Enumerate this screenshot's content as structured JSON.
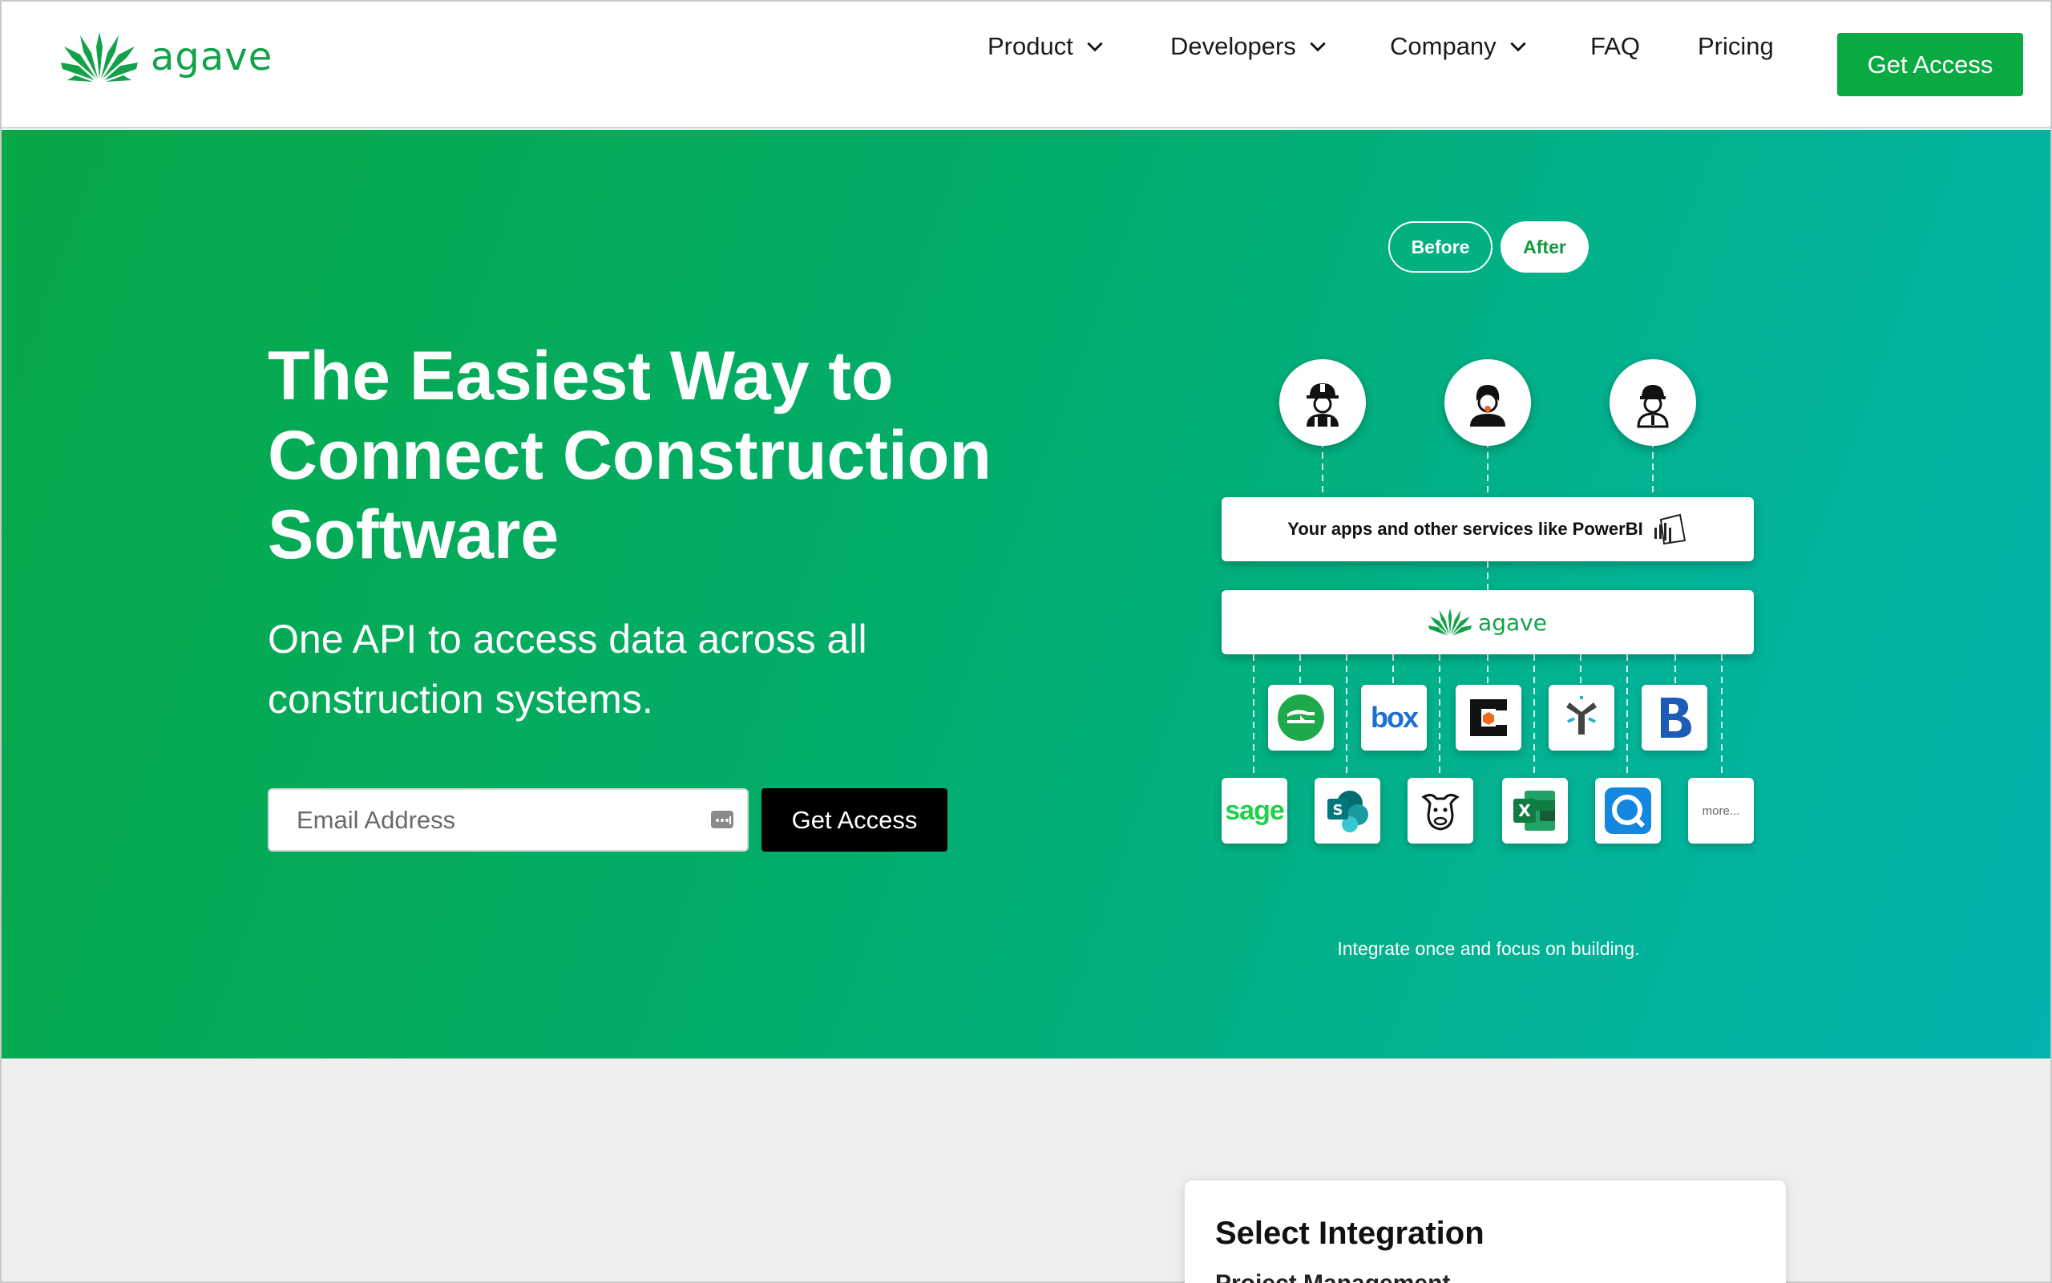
{
  "nav": {
    "logo_text": "agave",
    "items": [
      {
        "label": "Product",
        "has_dropdown": true
      },
      {
        "label": "Developers",
        "has_dropdown": true
      },
      {
        "label": "Company",
        "has_dropdown": true
      },
      {
        "label": "FAQ",
        "has_dropdown": false
      },
      {
        "label": "Pricing",
        "has_dropdown": false
      }
    ],
    "cta_label": "Get Access",
    "cta_color": "#0aaa42"
  },
  "hero": {
    "title": "The Easiest Way to Connect Construction Software",
    "subtitle": "One API to access data across all construction systems.",
    "email_placeholder": "Email Address",
    "cta_label": "Get Access",
    "gradient_start": "#07a847",
    "gradient_end": "#02b3ae",
    "toggle": {
      "before": "Before",
      "after": "After",
      "selected": "After"
    },
    "diagram": {
      "users": [
        "construction-worker-icon",
        "support-agent-icon",
        "engineer-icon"
      ],
      "apps_box_label": "Your apps and other services like PowerBI",
      "apps_box_icon": "powerbi-icon",
      "hub_label": "agave",
      "integrations_row1": [
        "procore-icon",
        "box",
        "c-logo-icon",
        "y-logo-icon",
        "b-logo-icon"
      ],
      "integrations_row2": [
        "sage",
        "sharepoint-icon",
        "bull-logo-icon",
        "excel-icon",
        "q-logo-icon",
        "more..."
      ],
      "box_label": "box",
      "sage_label": "sage",
      "more_label": "more..."
    },
    "caption": "Integrate once and focus on building."
  },
  "integration_card": {
    "title": "Select Integration",
    "subtitle": "Project Management"
  }
}
